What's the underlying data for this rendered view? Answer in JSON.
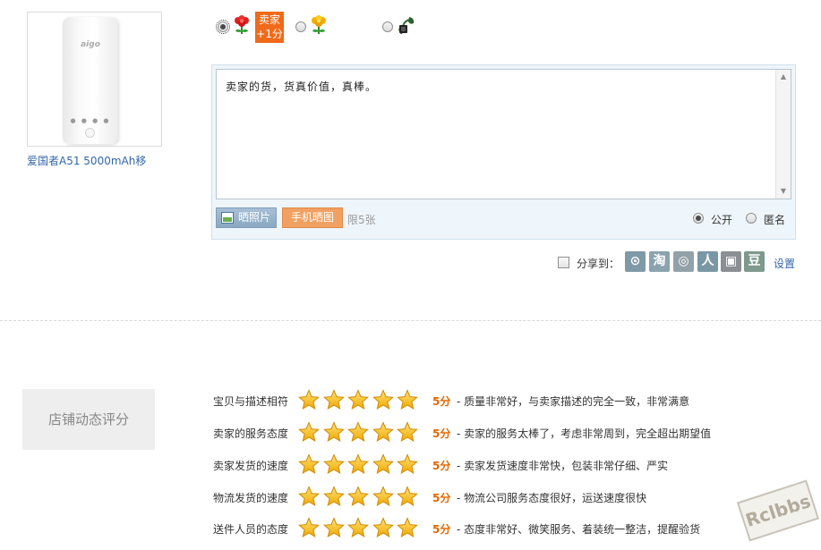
{
  "product": {
    "brand_logo": "aigo",
    "name": "爱国者A51 5000mAh移"
  },
  "rating_options": {
    "seller_badge_line1": "卖家",
    "seller_badge_line2": "+1分",
    "good_icon": "red-flower-icon",
    "neutral_icon": "yellow-flower-icon",
    "bad_icon": "wilted-flower-icon",
    "selected": "good"
  },
  "comment": {
    "text": "卖家的货，货真价值，真棒。",
    "photo_button": "晒照片",
    "mobile_button": "手机晒图",
    "limit": "限5张",
    "public_label": "公开",
    "anonymous_label": "匿名",
    "visibility": "public"
  },
  "share": {
    "label": "分享到：",
    "settings": "设置",
    "services": [
      {
        "name": "kaixin",
        "glyph": "⊙",
        "color": "#7f9aa6"
      },
      {
        "name": "taobao",
        "glyph": "淘",
        "color": "#8aa3ad"
      },
      {
        "name": "weibo",
        "glyph": "◎",
        "color": "#93a2a8"
      },
      {
        "name": "renren",
        "glyph": "人",
        "color": "#7a97a5"
      },
      {
        "name": "kaixin001",
        "glyph": "▣",
        "color": "#8a8f94"
      },
      {
        "name": "douban",
        "glyph": "豆",
        "color": "#7e9a8c"
      }
    ]
  },
  "store_rating": {
    "title": "店铺动态评分",
    "rows": [
      {
        "label": "宝贝与描述相符",
        "stars": 5,
        "score": "5分",
        "desc": "- 质量非常好，与卖家描述的完全一致，非常满意"
      },
      {
        "label": "卖家的服务态度",
        "stars": 5,
        "score": "5分",
        "desc": "- 卖家的服务太棒了，考虑非常周到，完全超出期望值"
      },
      {
        "label": "卖家发货的速度",
        "stars": 5,
        "score": "5分",
        "desc": "- 卖家发货速度非常快，包装非常仔细、严实"
      },
      {
        "label": "物流发货的速度",
        "stars": 5,
        "score": "5分",
        "desc": "- 物流公司服务态度很好，运送速度很快"
      },
      {
        "label": "送件人员的态度",
        "stars": 5,
        "score": "5分",
        "desc": "- 态度非常好、微笑服务、着装统一整洁，提醒验货"
      }
    ]
  },
  "watermark": "Rclbbs",
  "colors": {
    "accent": "#f06a1a",
    "link": "#3366aa",
    "score": "#e56600",
    "star": "#f5b400"
  }
}
